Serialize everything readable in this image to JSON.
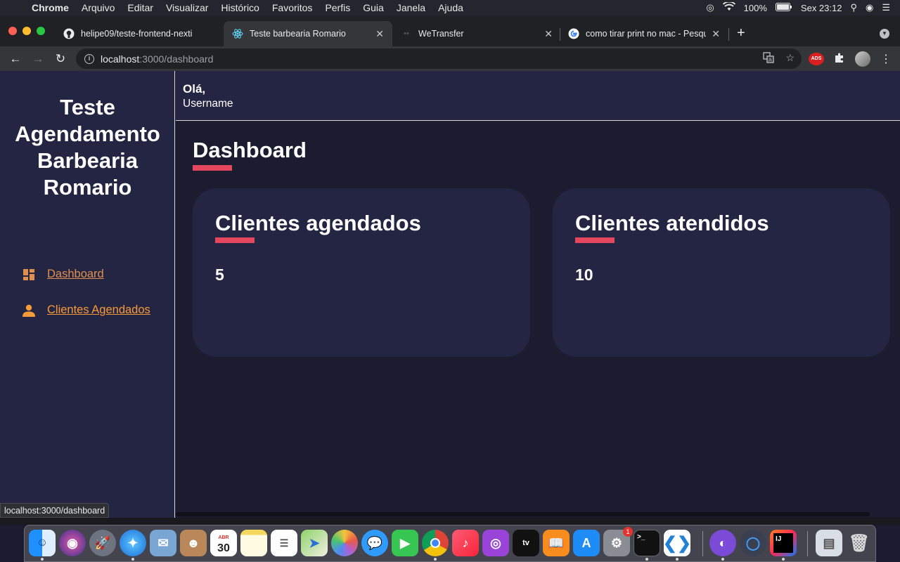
{
  "menubar": {
    "apple": "",
    "items": [
      "Chrome",
      "Arquivo",
      "Editar",
      "Visualizar",
      "Histórico",
      "Favoritos",
      "Perfis",
      "Guia",
      "Janela",
      "Ajuda"
    ],
    "battery": "100%",
    "clock": "Sex 23:12"
  },
  "tabs": [
    {
      "title": "helipe09/teste-frontend-nexti",
      "favicon": "github-icon"
    },
    {
      "title": "Teste barbearia Romario",
      "favicon": "react-icon"
    },
    {
      "title": "WeTransfer",
      "favicon": "wetransfer-icon"
    },
    {
      "title": "como tirar print no mac - Pesqu",
      "favicon": "google-icon"
    }
  ],
  "address": {
    "host": "localhost",
    "path": ":3000/dashboard"
  },
  "app": {
    "brand": "Teste Agendamento Barbearia Romario",
    "nav": [
      {
        "label": "Dashboard",
        "icon": "dashboard-icon"
      },
      {
        "label": "Clientes Agendados",
        "icon": "person-icon"
      }
    ],
    "header": {
      "greeting": "Olá,",
      "username": "Username"
    },
    "page_title": "Dashboard",
    "cards": [
      {
        "title": "Clientes agendados",
        "value": "5"
      },
      {
        "title": "Clientes atendidos",
        "value": "10"
      }
    ],
    "colors": {
      "accent": "#e4475d",
      "link": "#f79a3a",
      "panel": "#232542",
      "background": "#1b1c30"
    }
  },
  "status_url": "localhost:3000/dashboard",
  "dock": {
    "calendar_month": "ABR",
    "calendar_day": "30",
    "notification_badge": "1",
    "intellij_label": "IJ"
  }
}
